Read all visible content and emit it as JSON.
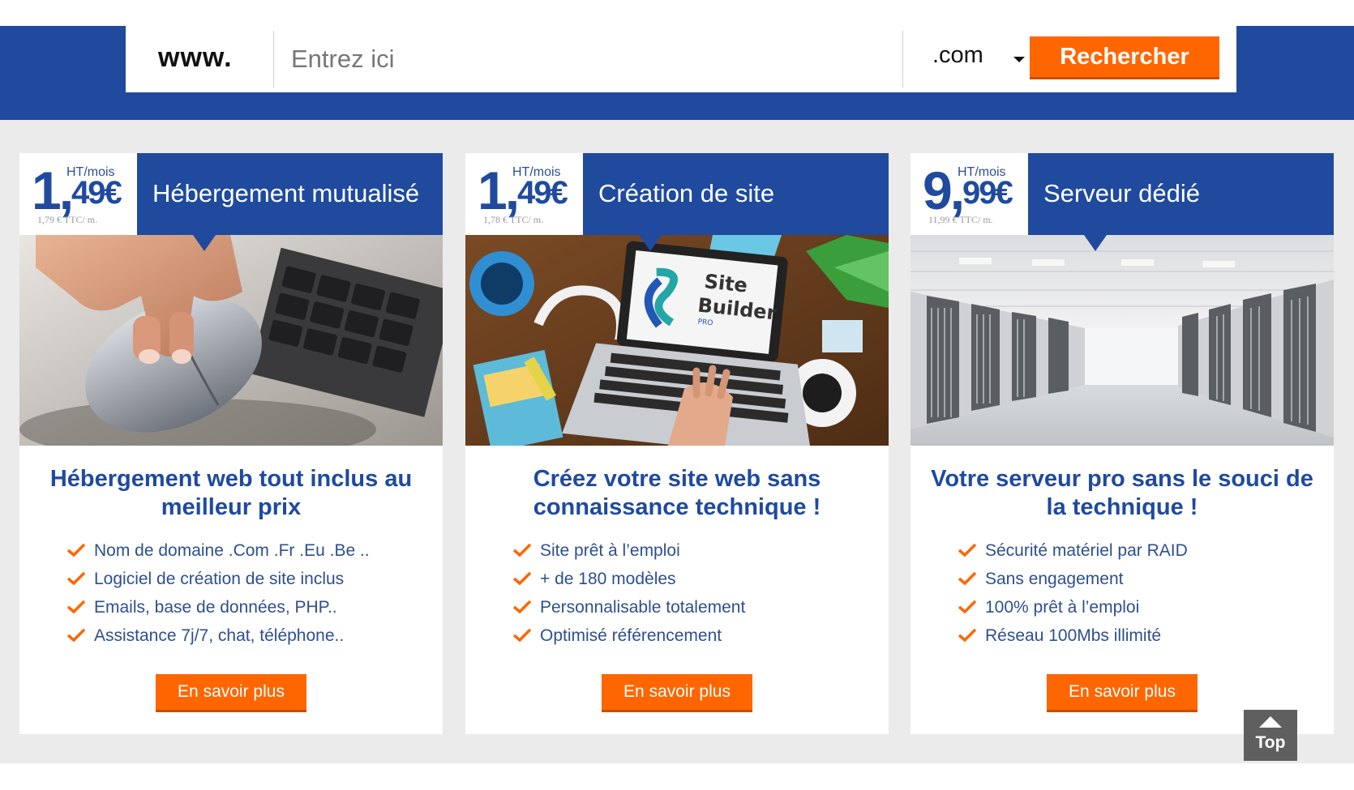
{
  "search": {
    "prefix": "www.",
    "placeholder": "Entrez ici",
    "tld": ".com",
    "button": "Rechercher"
  },
  "cards": [
    {
      "price_main": "1,",
      "price_cents": "49€",
      "price_unit": "HT/mois",
      "price_ttc": "1,79 € TTC/ m.",
      "title": "Hébergement mutualisé",
      "photo_icon": "mouse-keyboard-photo",
      "headline": "Hébergement web tout inclus au meilleur prix",
      "features": [
        "Nom de domaine .Com .Fr .Eu .Be ..",
        "Logiciel de création de site inclus",
        "Emails, base de données, PHP..",
        "Assistance 7j/7, chat, téléphone.."
      ],
      "button": "En savoir plus"
    },
    {
      "price_main": "1,",
      "price_cents": "49€",
      "price_unit": "HT/mois",
      "price_ttc": "1,78 € TTC/ m.",
      "title": "Création de site",
      "photo_icon": "laptop-site-builder-photo",
      "photo_logo_text": [
        "Site",
        "Builder",
        "PRO"
      ],
      "headline": "Créez votre site web sans connaissance technique !",
      "features": [
        "Site prêt à l’emploi",
        "+ de 180 modèles",
        "Personnalisable totalement",
        "Optimisé référencement"
      ],
      "button": "En savoir plus"
    },
    {
      "price_main": "9,",
      "price_cents": "99€",
      "price_unit": "HT/mois",
      "price_ttc": "11,99 € TTC/ m.",
      "title": "Serveur dédié",
      "photo_icon": "server-room-photo",
      "headline": "Votre serveur pro sans le souci de la technique !",
      "features": [
        "Sécurité matériel par RAID",
        "Sans engagement",
        "100% prêt à l’emploi",
        "Réseau 100Mbs illimité"
      ],
      "button": "En savoir plus"
    }
  ],
  "top_button": "Top",
  "colors": {
    "brand_blue": "#1f4a9e",
    "accent_orange": "#ff6600",
    "background_grey": "#ebebeb"
  }
}
